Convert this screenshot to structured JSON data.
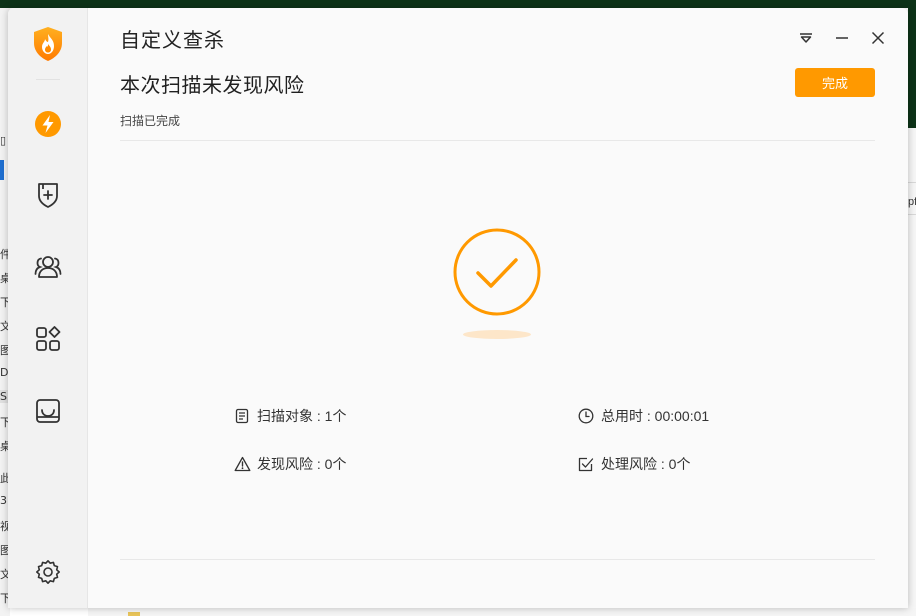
{
  "app": {
    "title": "自定义查杀",
    "headline": "本次扫描未发现风险",
    "status": "扫描已完成",
    "done_button": "完成"
  },
  "sidebar": {
    "items": [
      {
        "name": "speedup",
        "icon": "lightning-icon"
      },
      {
        "name": "protection",
        "icon": "shield-plus-icon"
      },
      {
        "name": "users",
        "icon": "users-icon"
      },
      {
        "name": "apps",
        "icon": "apps-grid-icon"
      },
      {
        "name": "toolbox",
        "icon": "tray-icon"
      },
      {
        "name": "settings",
        "icon": "gear-icon"
      }
    ]
  },
  "stats": {
    "scan_objects": "扫描对象 : 1个",
    "total_time": "总用时 : 00:00:01",
    "found_risks": "发现风险 : 0个",
    "handled_risks": "处理风险 : 0个"
  },
  "background": {
    "left_fragments": [
      "件",
      "桌",
      "下",
      "文",
      "图",
      "D",
      "S",
      "下",
      "桌",
      "此",
      "3",
      "视",
      "图",
      "文",
      "下"
    ],
    "right_fragment": "pf"
  },
  "colors": {
    "accent": "#ff9900",
    "sidebar_bg": "#f2f2f2",
    "window_bg": "#fafafa"
  }
}
